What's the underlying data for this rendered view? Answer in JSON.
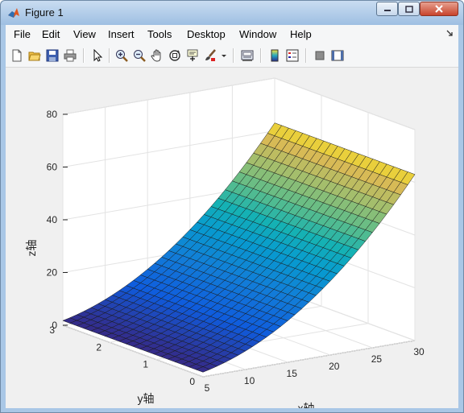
{
  "window": {
    "title": "Figure 1"
  },
  "menu": {
    "items": [
      "File",
      "Edit",
      "View",
      "Insert",
      "Tools",
      "Desktop",
      "Window",
      "Help"
    ]
  },
  "toolbar": {
    "icons": [
      "new-figure-icon",
      "open-file-icon",
      "save-icon",
      "print-icon",
      "edit-plot-arrow-icon",
      "zoom-in-icon",
      "zoom-out-icon",
      "pan-hand-icon",
      "rotate-3d-icon",
      "data-cursor-icon",
      "brush-icon",
      "brush-dropdown-icon",
      "link-plot-icon",
      "colorbar-icon",
      "legend-icon",
      "hide-plot-tools-icon",
      "show-plot-tools-icon"
    ]
  },
  "chart_data": {
    "type": "surface",
    "title": "",
    "xlabel": "x轴",
    "ylabel": "y轴",
    "zlabel": "z轴",
    "x": [
      5,
      30
    ],
    "y": [
      0,
      3
    ],
    "xlim": [
      5,
      30
    ],
    "ylim": [
      0,
      3
    ],
    "zlim": [
      0,
      80
    ],
    "xticks": [
      5,
      10,
      15,
      20,
      25,
      30
    ],
    "yticks": [
      0,
      1,
      2,
      3
    ],
    "zticks": [
      0,
      20,
      40,
      60,
      80
    ],
    "function": "z = 0.07 * x^2",
    "corner_values": {
      "x5": 1.75,
      "x30": 63
    },
    "colormap": "parula",
    "grid": true
  }
}
